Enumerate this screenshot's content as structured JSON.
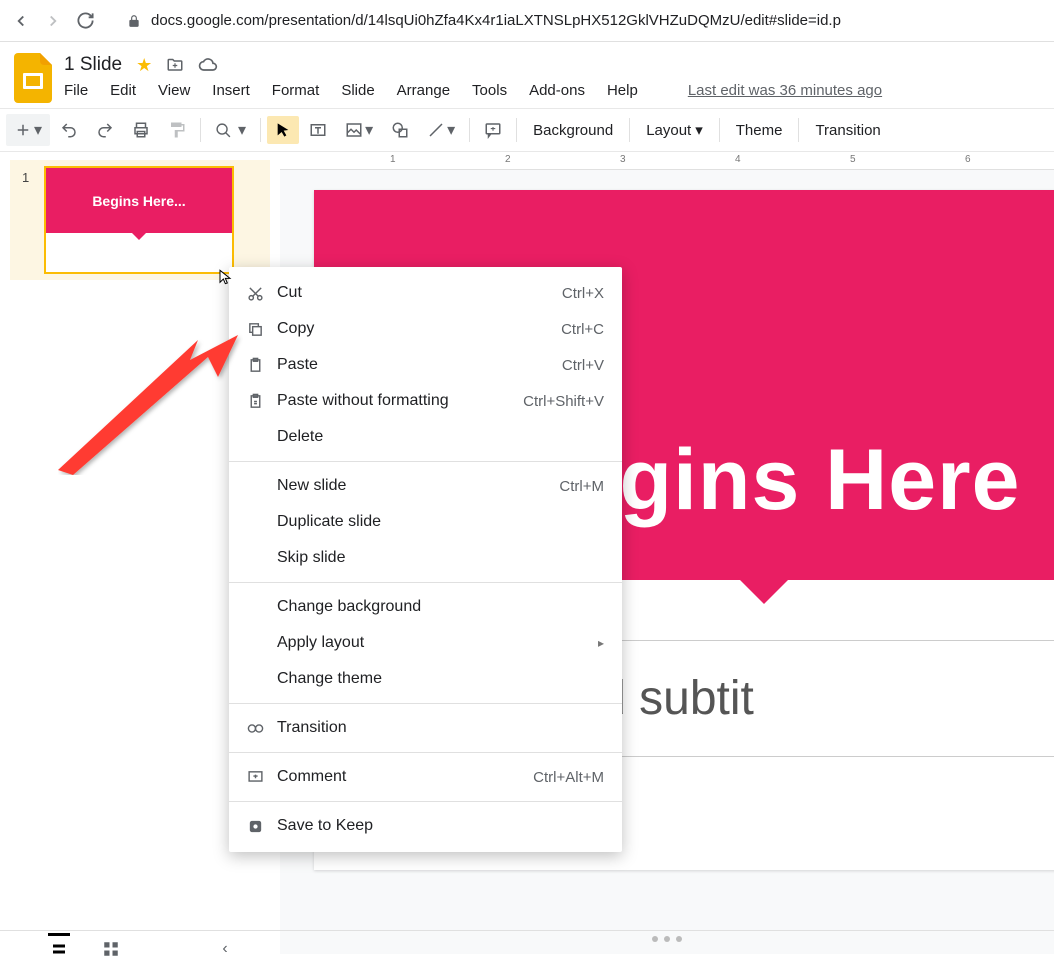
{
  "browser": {
    "url": "docs.google.com/presentation/d/14lsqUi0hZfa4Kx4r1iaLXTNSLpHX512GklVHZuDQMzU/edit#slide=id.p"
  },
  "doc": {
    "title": "1 Slide",
    "last_edit": "Last edit was 36 minutes ago"
  },
  "menus": {
    "file": "File",
    "edit": "Edit",
    "view": "View",
    "insert": "Insert",
    "format": "Format",
    "slide": "Slide",
    "arrange": "Arrange",
    "tools": "Tools",
    "addons": "Add-ons",
    "help": "Help"
  },
  "toolbar": {
    "background": "Background",
    "layout": "Layout",
    "theme": "Theme",
    "transition": "Transition"
  },
  "ruler": {
    "t1": "1",
    "t2": "2",
    "t3": "3",
    "t4": "4",
    "t5": "5",
    "t6": "6"
  },
  "thumbnail": {
    "number": "1",
    "text": "Begins Here..."
  },
  "slide": {
    "title": "Begins Here",
    "subtitle": "Click to add subtit"
  },
  "context": {
    "cut": {
      "label": "Cut",
      "short": "Ctrl+X"
    },
    "copy": {
      "label": "Copy",
      "short": "Ctrl+C"
    },
    "paste": {
      "label": "Paste",
      "short": "Ctrl+V"
    },
    "paste_nf": {
      "label": "Paste without formatting",
      "short": "Ctrl+Shift+V"
    },
    "delete": {
      "label": "Delete"
    },
    "new_slide": {
      "label": "New slide",
      "short": "Ctrl+M"
    },
    "dup": {
      "label": "Duplicate slide"
    },
    "skip": {
      "label": "Skip slide"
    },
    "bg": {
      "label": "Change background"
    },
    "layout": {
      "label": "Apply layout"
    },
    "theme": {
      "label": "Change theme"
    },
    "transition": {
      "label": "Transition"
    },
    "comment": {
      "label": "Comment",
      "short": "Ctrl+Alt+M"
    },
    "keep": {
      "label": "Save to Keep"
    }
  }
}
